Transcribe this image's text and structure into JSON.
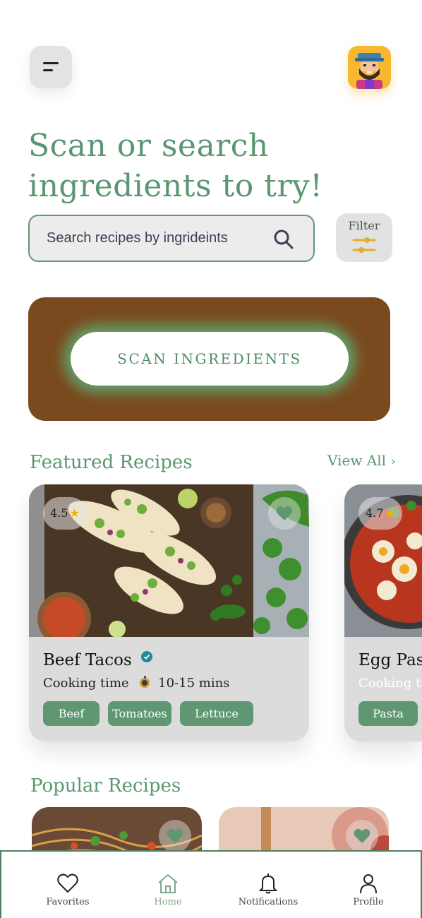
{
  "header": {
    "menu_icon": "menu-icon",
    "avatar": "bearded-man-avatar"
  },
  "headline": {
    "line1": "Scan or search",
    "line2": "ingredients to try!"
  },
  "search": {
    "placeholder": "Search recipes by ingrideints",
    "icon": "search-icon"
  },
  "filter": {
    "label": "Filter",
    "icon": "sliders-icon"
  },
  "scan": {
    "button_label": "SCAN INGREDIENTS"
  },
  "featured": {
    "title": "Featured Recipes",
    "view_all": "View All",
    "cards": [
      {
        "rating": "4.5",
        "title": "Beef Tacos",
        "time": "Cooking time",
        "duration": "10-15 mins",
        "tags": [
          "Beef",
          "Tomatoes",
          "Lettuce"
        ]
      },
      {
        "rating": "4.7",
        "title": "Egg Past",
        "time": "Cooking tir",
        "tags": [
          "Pasta"
        ]
      }
    ]
  },
  "popular": {
    "title": "Popular Recipes"
  },
  "tabbar": {
    "items": [
      {
        "label": "Favorites",
        "icon": "heart-icon"
      },
      {
        "label": "Home",
        "icon": "home-icon"
      },
      {
        "label": "Notifications",
        "icon": "bell-icon"
      },
      {
        "label": "Profile",
        "icon": "user-icon"
      }
    ]
  },
  "colors": {
    "accent": "#5a9670",
    "tag": "#5e9772",
    "scan_card": "#7a4a1e",
    "avatar_bg": "#f7b731"
  }
}
